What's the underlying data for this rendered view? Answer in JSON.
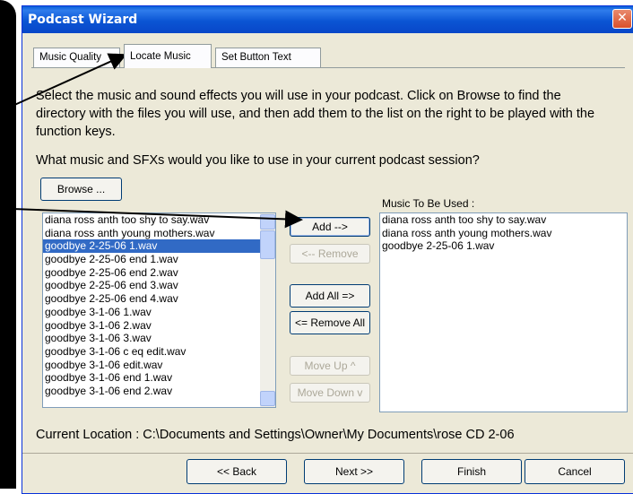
{
  "window": {
    "title": "Podcast Wizard",
    "close_symbol": "✕"
  },
  "tabs": [
    {
      "label": "Music Quality",
      "key": "Q"
    },
    {
      "label": "Locate Music",
      "key": "L"
    },
    {
      "label": "Set Button Text",
      "key": "S"
    }
  ],
  "description": "Select the music and sound effects you will use in your podcast.  Click on Browse to find the directory with the files you will use, and then add them to the list on the right to be played with the function keys.",
  "question": "What music and SFXs would you like to use in your current podcast session?",
  "browse_label": "Browse ...",
  "music_used_label": "Music To Be Used :",
  "source_list": [
    "diana ross anth too shy to say.wav",
    "diana ross anth young mothers.wav",
    "goodbye 2-25-06 1.wav",
    "goodbye 2-25-06 end 1.wav",
    "goodbye 2-25-06 end 2.wav",
    "goodbye 2-25-06 end 3.wav",
    "goodbye 2-25-06 end 4.wav",
    "goodbye 3-1-06 1.wav",
    "goodbye 3-1-06 2.wav",
    "goodbye 3-1-06 3.wav",
    "goodbye 3-1-06 c eq edit.wav",
    "goodbye 3-1-06 edit.wav",
    "goodbye 3-1-06 end 1.wav",
    "goodbye 3-1-06 end 2.wav"
  ],
  "selected_source_index": 2,
  "used_list": [
    "diana ross anth too shy to say.wav",
    "diana ross anth young mothers.wav",
    "goodbye 2-25-06 1.wav"
  ],
  "buttons": {
    "add": "Add -->",
    "remove": "<-- Remove",
    "add_all": "Add All =>",
    "remove_all": "<= Remove All",
    "move_up": "Move Up  ^",
    "move_down": "Move Down v"
  },
  "current_location": "Current Location : C:\\Documents and Settings\\Owner\\My Documents\\rose CD 2-06",
  "nav": {
    "back": "<< Back",
    "next": "Next >>",
    "finish": "Finish",
    "cancel": "Cancel"
  },
  "colors": {
    "titlebar": "#0b55d4",
    "dialog_bg": "#ece9d8",
    "selection": "#316ac5"
  }
}
